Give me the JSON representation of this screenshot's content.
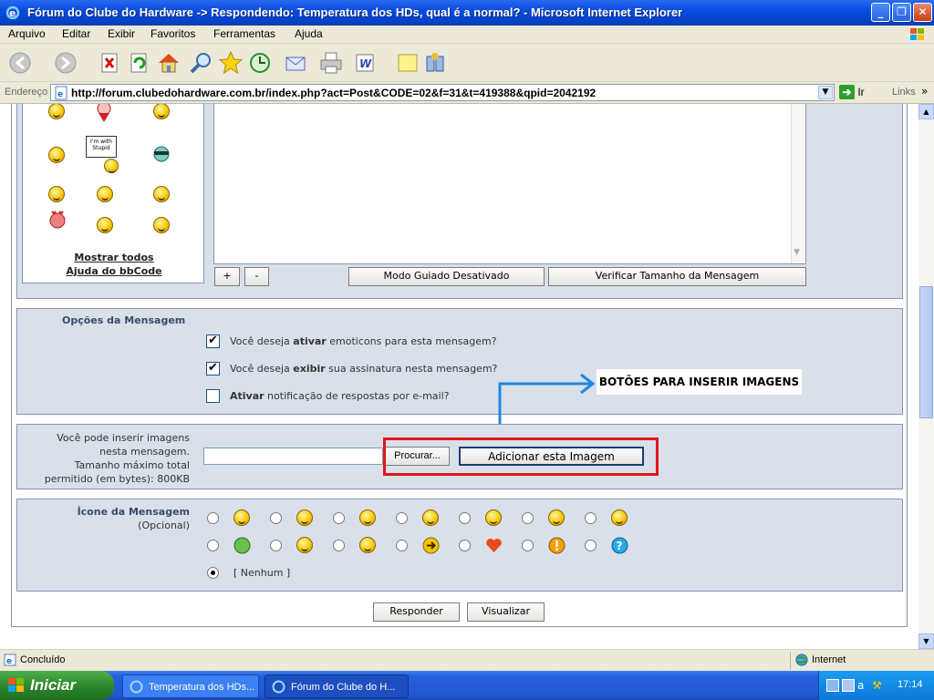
{
  "window": {
    "title": "Fórum do Clube do Hardware -> Respondendo: Temperatura dos HDs, qual é a normal? - Microsoft Internet Explorer"
  },
  "menu": [
    "Arquivo",
    "Editar",
    "Exibir",
    "Favoritos",
    "Ferramentas",
    "Ajuda"
  ],
  "address": {
    "label": "Endereço",
    "url": "http://forum.clubedohardware.com.br/index.php?act=Post&CODE=02&f=31&t=419388&qpid=2042192",
    "go": "Ir",
    "links": "Links"
  },
  "emoticons": {
    "show_all": "Mostrar todos",
    "bbcode_help": "Ajuda do bbCode",
    "sign_text": "I'm with Stupid"
  },
  "editor": {
    "plus": "+",
    "minus": "-",
    "guided_mode": "Modo Guiado Desativado",
    "check_size": "Verificar Tamanho da Mensagem"
  },
  "options": {
    "title": "Opções da Mensagem",
    "items": [
      {
        "pre": "Você deseja ",
        "bold": "ativar",
        "post": " emoticons para esta mensagem?",
        "checked": true
      },
      {
        "pre": "Você deseja ",
        "bold": "exibir",
        "post": " sua assinatura nesta mensagem?",
        "checked": true
      },
      {
        "pre": "",
        "bold": "Ativar",
        "post": " notificação de respostas por e-mail?",
        "checked": false
      }
    ]
  },
  "annotation": {
    "text": "BOTÕES PARA INSERIR IMAGENS",
    "color": "#1e88e5",
    "box_color": "#e01818"
  },
  "upload": {
    "desc_lines": [
      "Você pode inserir imagens",
      "nesta mensagem.",
      "Tamanho máximo total",
      "permitido (em bytes): 800KB"
    ],
    "browse": "Procurar...",
    "add": "Adicionar esta Imagem"
  },
  "icon": {
    "title": "Ícone da Mensagem",
    "subtitle": "(Opcional)",
    "none": "[ Nenhum ]"
  },
  "actions": {
    "reply": "Responder",
    "preview": "Visualizar"
  },
  "status": {
    "text": "Concluído",
    "zone": "Internet"
  },
  "taskbar": {
    "start": "Iniciar",
    "tasks": [
      "Temperatura dos HDs...",
      "Fórum do Clube do H..."
    ],
    "clock": "17:14"
  }
}
